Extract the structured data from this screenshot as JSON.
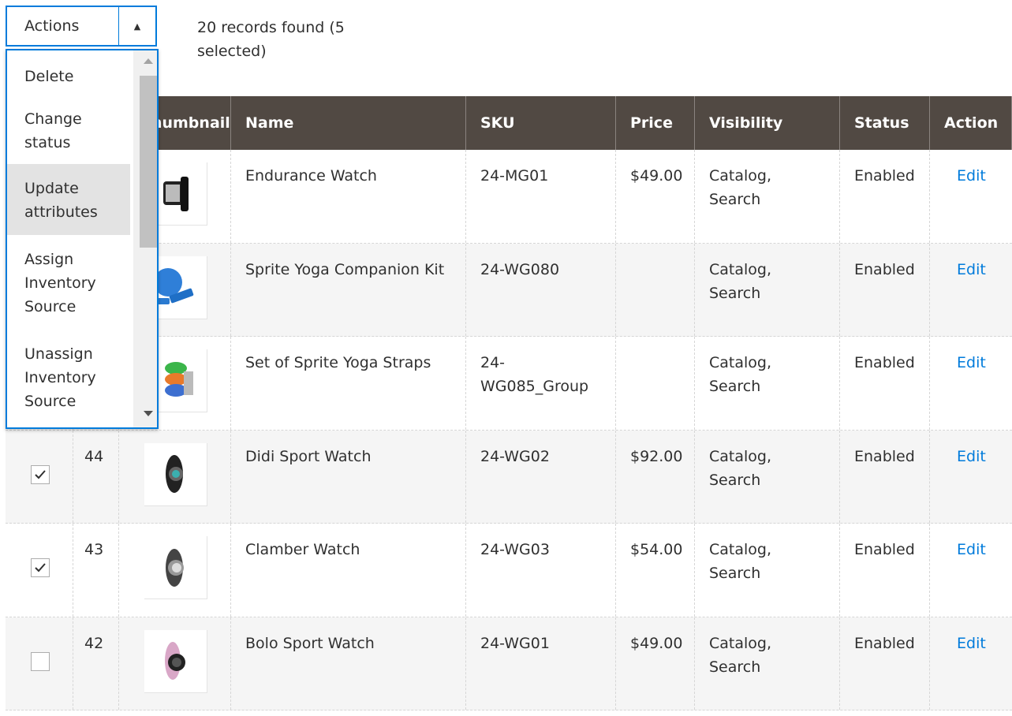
{
  "toolbar": {
    "actions_label": "Actions",
    "records_text": "20 records found (5 selected)"
  },
  "dropdown": {
    "items": [
      {
        "label": "Delete"
      },
      {
        "label": "Change status"
      },
      {
        "label": "Update attributes",
        "hovered": true
      },
      {
        "label": "Assign Inventory Source"
      },
      {
        "label": "Unassign Inventory Source"
      }
    ]
  },
  "table": {
    "headers": {
      "thumbnail": "Thumbnail",
      "name": "Name",
      "sku": "SKU",
      "price": "Price",
      "visibility": "Visibility",
      "status": "Status",
      "action": "Action"
    },
    "rows": [
      {
        "id": "",
        "name": "Endurance Watch",
        "sku": "24-MG01",
        "price": "$49.00",
        "visibility": "Catalog, Search",
        "status": "Enabled",
        "action": "Edit",
        "checked": null,
        "thumb": "watch-black"
      },
      {
        "id": "",
        "name": "Sprite Yoga Companion Kit",
        "sku": "24-WG080",
        "price": "",
        "visibility": "Catalog, Search",
        "status": "Enabled",
        "action": "Edit",
        "checked": null,
        "thumb": "yoga-kit"
      },
      {
        "id": "",
        "name": "Set of Sprite Yoga Straps",
        "sku": "24-WG085_Group",
        "price": "",
        "visibility": "Catalog, Search",
        "status": "Enabled",
        "action": "Edit",
        "checked": null,
        "thumb": "yoga-straps"
      },
      {
        "id": "44",
        "name": "Didi Sport Watch",
        "sku": "24-WG02",
        "price": "$92.00",
        "visibility": "Catalog, Search",
        "status": "Enabled",
        "action": "Edit",
        "checked": true,
        "thumb": "watch-teal"
      },
      {
        "id": "43",
        "name": "Clamber Watch",
        "sku": "24-WG03",
        "price": "$54.00",
        "visibility": "Catalog, Search",
        "status": "Enabled",
        "action": "Edit",
        "checked": true,
        "thumb": "watch-grey"
      },
      {
        "id": "42",
        "name": "Bolo Sport Watch",
        "sku": "24-WG01",
        "price": "$49.00",
        "visibility": "Catalog, Search",
        "status": "Enabled",
        "action": "Edit",
        "checked": false,
        "thumb": "watch-pink"
      }
    ]
  },
  "colors": {
    "accent": "#007bdb",
    "header_bg": "#514943",
    "row_alt": "#f5f5f5"
  }
}
